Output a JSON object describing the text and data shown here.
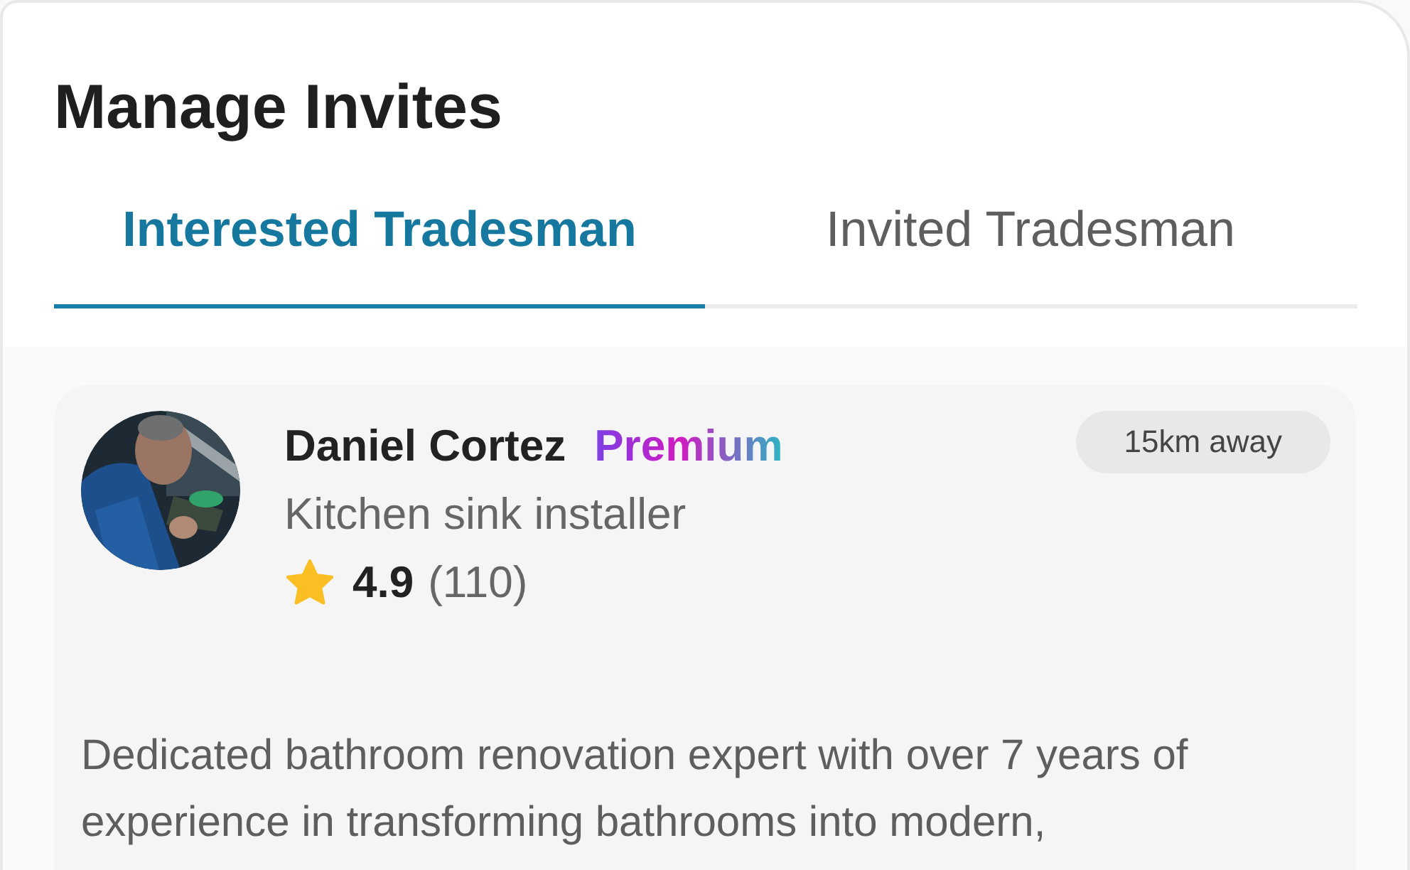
{
  "title": "Manage Invites",
  "tabs": [
    {
      "label": "Interested Tradesman",
      "selected": true
    },
    {
      "label": "Invited Tradesman",
      "selected": false
    }
  ],
  "cards": [
    {
      "name": "Daniel Cortez",
      "badge": "Premium",
      "distance": "15km away",
      "trade": "Kitchen sink installer",
      "rating": "4.9",
      "reviews": "(110)",
      "description": "Dedicated bathroom renovation expert with over 7 years of experience in transforming bathrooms into modern,"
    }
  ]
}
